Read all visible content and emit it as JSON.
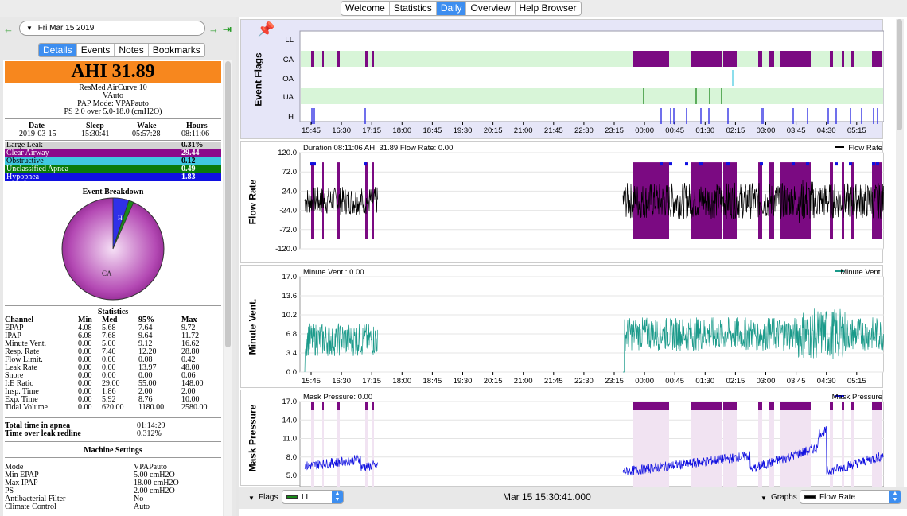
{
  "tabs": [
    "Welcome",
    "Statistics",
    "Daily",
    "Overview",
    "Help Browser"
  ],
  "active_tab": "Daily",
  "date_label": "Fri Mar 15 2019",
  "subtabs": [
    "Details",
    "Events",
    "Notes",
    "Bookmarks"
  ],
  "active_subtab": "Details",
  "ahi": "AHI 31.89",
  "machine": [
    "ResMed AirCurve 10",
    "VAuto",
    "PAP Mode: VPAPauto",
    "PS 2.0 over 5.0-18.0 (cmH2O)"
  ],
  "session": {
    "headers": [
      "Date",
      "Sleep",
      "Wake",
      "Hours"
    ],
    "values": [
      "2019-03-15",
      "15:30:41",
      "05:57:28",
      "08:11:06"
    ]
  },
  "indices": [
    {
      "label": "Large Leak",
      "value": "0.31%",
      "bg": "#d3d3d3",
      "fg": "#000"
    },
    {
      "label": "Clear Airway",
      "value": "29.44",
      "bg": "#8b0a8b",
      "fg": "#fff"
    },
    {
      "label": "Obstructive",
      "value": "0.12",
      "bg": "#40c8e0",
      "fg": "#000"
    },
    {
      "label": "Unclassified Apnea",
      "value": "0.49",
      "bg": "#0a7a0a",
      "fg": "#fff"
    },
    {
      "label": "Hypopnea",
      "value": "1.83",
      "bg": "#1010e0",
      "fg": "#fff"
    }
  ],
  "breakdown_title": "Event Breakdown",
  "pie_labels": {
    "ca": "CA",
    "h": "H"
  },
  "stats": {
    "title": "Statistics",
    "headers": [
      "Channel",
      "Min",
      "Med",
      "95%",
      "Max"
    ],
    "rows": [
      [
        "EPAP",
        "4.08",
        "5.68",
        "7.64",
        "9.72"
      ],
      [
        "IPAP",
        "6.08",
        "7.68",
        "9.64",
        "11.72"
      ],
      [
        "Minute Vent.",
        "0.00",
        "5.00",
        "9.12",
        "16.62"
      ],
      [
        "Resp. Rate",
        "0.00",
        "7.40",
        "12.20",
        "28.80"
      ],
      [
        "Flow Limit.",
        "0.00",
        "0.00",
        "0.08",
        "0.42"
      ],
      [
        "Leak Rate",
        "0.00",
        "0.00",
        "13.97",
        "48.00"
      ],
      [
        "Snore",
        "0.00",
        "0.00",
        "0.00",
        "0.06"
      ],
      [
        "I:E Ratio",
        "0.00",
        "29.00",
        "55.00",
        "148.00"
      ],
      [
        "Insp. Time",
        "0.00",
        "1.86",
        "2.00",
        "2.00"
      ],
      [
        "Exp. Time",
        "0.00",
        "5.92",
        "8.76",
        "10.00"
      ],
      [
        "Tidal Volume",
        "0.00",
        "620.00",
        "1180.00",
        "2580.00"
      ]
    ]
  },
  "apnea": [
    {
      "label": "Total time in apnea",
      "value": "01:14:29"
    },
    {
      "label": "Time over leak redline",
      "value": "0.312%"
    }
  ],
  "settings": {
    "title": "Machine Settings",
    "rows": [
      [
        "Mode",
        "VPAPauto"
      ],
      [
        "Min EPAP",
        "5.00 cmH2O"
      ],
      [
        "Max IPAP",
        "18.00 cmH2O"
      ],
      [
        "PS",
        "2.00 cmH2O"
      ],
      [
        "Antibacterial Filter",
        "No"
      ],
      [
        "Climate Control",
        "Auto"
      ]
    ]
  },
  "time_ticks": [
    "15:45",
    "16:30",
    "17:15",
    "18:00",
    "18:45",
    "19:30",
    "20:15",
    "21:00",
    "21:45",
    "22:30",
    "23:15",
    "00:00",
    "00:45",
    "01:30",
    "02:15",
    "03:00",
    "03:45",
    "04:30",
    "05:15"
  ],
  "graphs": {
    "flags": {
      "title": "Event Flags",
      "rows": [
        "LL",
        "CA",
        "OA",
        "UA",
        "H"
      ]
    },
    "flow": {
      "title": "Flow Rate",
      "header": "Duration 08:11:06 AHI 31.89 Flow Rate: 0.00",
      "legend": "Flow Rate",
      "ticks": [
        "120.0",
        "72.0",
        "24.0",
        "-24.0",
        "-72.0",
        "-120.0"
      ]
    },
    "mv": {
      "title": "Minute Vent.",
      "header": "Minute Vent.: 0.00",
      "legend": "Minute Vent.",
      "ticks": [
        "17.0",
        "13.6",
        "10.2",
        "6.8",
        "3.4",
        "0.0"
      ]
    },
    "mp": {
      "title": "Mask Pressure",
      "header": "Mask Pressure: 0.00",
      "legend": "Mask Pressure",
      "ticks": [
        "17.0",
        "14.0",
        "11.0",
        "8.0",
        "5.0"
      ]
    }
  },
  "bottom": {
    "flags_label": "Flags",
    "flags_select": "LL",
    "time": "Mar 15 15:30:41.000",
    "graphs_label": "Graphs",
    "graphs_select": "Flow Rate"
  },
  "colors": {
    "purple": "#7b0a82",
    "green_band": "#d8f5d8",
    "teal": "#1a9a8a",
    "blue": "#1010e0",
    "accent": "#3d8ef0"
  }
}
